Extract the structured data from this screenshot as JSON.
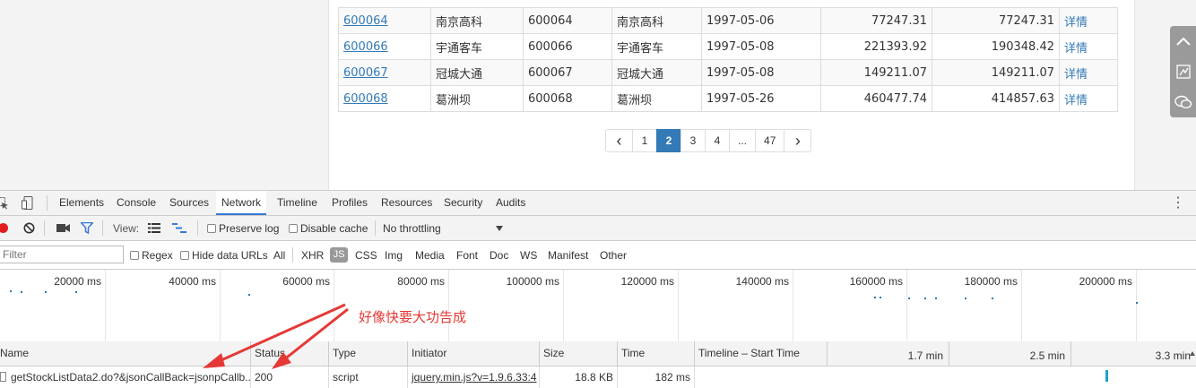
{
  "table": {
    "rows": [
      [
        "600064",
        "南京高科",
        "600064",
        "南京高科",
        "1997-05-06",
        "77247.31",
        "77247.31",
        "详情"
      ],
      [
        "600066",
        "宇通客车",
        "600066",
        "宇通客车",
        "1997-05-08",
        "221393.92",
        "190348.42",
        "详情"
      ],
      [
        "600067",
        "冠城大通",
        "600067",
        "冠城大通",
        "1997-05-08",
        "149211.07",
        "149211.07",
        "详情"
      ],
      [
        "600068",
        "葛洲坝",
        "600068",
        "葛洲坝",
        "1997-05-26",
        "460477.74",
        "414857.63",
        "详情"
      ]
    ]
  },
  "pagination": {
    "prev": "‹",
    "pages": [
      "1",
      "2",
      "3",
      "4",
      "...",
      "47"
    ],
    "active": "2",
    "next": "›"
  },
  "devtools": {
    "tabs": [
      "Elements",
      "Console",
      "Sources",
      "Network",
      "Timeline",
      "Profiles",
      "Resources",
      "Security",
      "Audits"
    ],
    "active_tab": "Network",
    "more_icon": "⋮",
    "toolbar": {
      "view_label": "View:",
      "preserve_log": "Preserve log",
      "disable_cache": "Disable cache",
      "throttling": "No throttling"
    },
    "filter": {
      "placeholder": "Filter",
      "regex": "Regex",
      "hide_data_urls": "Hide data URLs",
      "types": [
        "All",
        "XHR",
        "JS",
        "CSS",
        "Img",
        "Media",
        "Font",
        "Doc",
        "WS",
        "Manifest",
        "Other"
      ],
      "active_type": "JS"
    },
    "overview_ticks": [
      "20000 ms",
      "40000 ms",
      "60000 ms",
      "80000 ms",
      "100000 ms",
      "120000 ms",
      "140000 ms",
      "160000 ms",
      "180000 ms",
      "200000 ms"
    ],
    "columns": {
      "name": "Name",
      "status": "Status",
      "type": "Type",
      "initiator": "Initiator",
      "size": "Size",
      "time": "Time",
      "timeline": "Timeline – Start Time",
      "timeline_ticks": [
        "1.7 min",
        "2.5 min",
        "3.3 min"
      ]
    },
    "request": {
      "name": "getStockListData2.do?&jsonCallBack=jsonpCallb...",
      "status": "200",
      "type": "script",
      "initiator": "jquery.min.js?v=1.9.6.33:4",
      "size": "18.8 KB",
      "time": "182 ms"
    }
  },
  "annotation": {
    "text": "好像快要大功告成",
    "color": "#e53935"
  },
  "colors": {
    "link": "#337ab7",
    "active_page": "#337ab7",
    "devtools_accent": "#3879d9",
    "record": "#e21e1e"
  }
}
